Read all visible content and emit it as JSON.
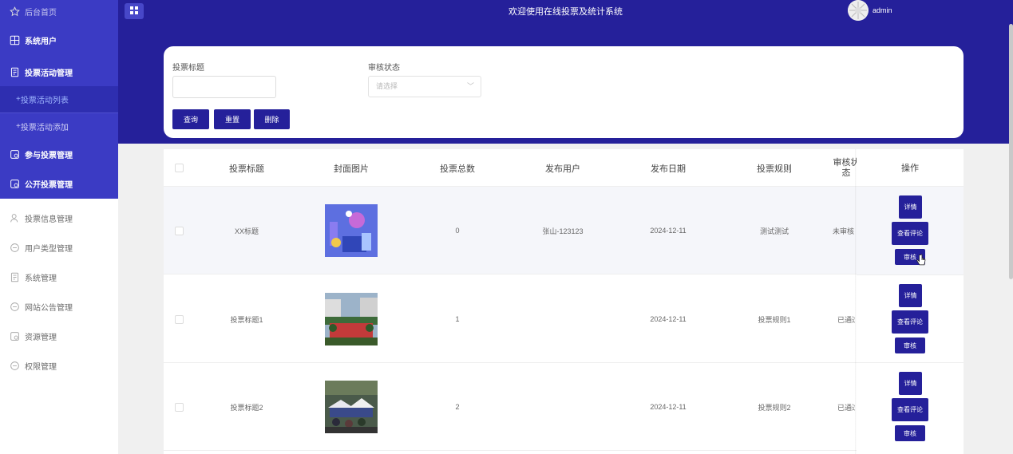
{
  "header": {
    "title": "欢迎使用在线投票及统计系统",
    "username": "admin"
  },
  "sidebar": {
    "home": "后台首页",
    "system_users": "系统用户",
    "vote_activity": "投票活动管理",
    "vote_activity_list": "投票活动列表",
    "vote_activity_add": "投票活动添加",
    "participate": "参与投票管理",
    "public_vote": "公开投票管理",
    "vote_info": "投票信息管理",
    "user_type": "用户类型管理",
    "system_mgmt": "系统管理",
    "announcements": "网站公告管理",
    "resources": "资源管理",
    "permissions": "权限管理",
    "sub_prefix": "+"
  },
  "search": {
    "title_label": "投票标题",
    "status_label": "审核状态",
    "status_placeholder": "请选择",
    "query_btn": "查询",
    "reset_btn": "重置",
    "delete_btn": "删除"
  },
  "table": {
    "headers": {
      "title": "投票标题",
      "cover": "封面图片",
      "total": "投票总数",
      "publisher": "发布用户",
      "date": "发布日期",
      "rules": "投票规则",
      "review": "审核状态",
      "ops": "操作"
    },
    "rows": [
      {
        "title": "XX标题",
        "total": "0",
        "publisher": "张山-123123",
        "date": "2024-12-11",
        "rules": "测试测试",
        "review": "未审核"
      },
      {
        "title": "投票标题1",
        "total": "1",
        "publisher": "",
        "date": "2024-12-11",
        "rules": "投票规则1",
        "review": "已通过"
      },
      {
        "title": "投票标题2",
        "total": "2",
        "publisher": "",
        "date": "2024-12-11",
        "rules": "投票规则2",
        "review": "已通过"
      }
    ],
    "actions": {
      "detail": "详情",
      "comments": "查看评论",
      "review": "审核"
    }
  },
  "colors": {
    "primary": "#25209a",
    "sidebar_active": "#3b3bc4"
  }
}
